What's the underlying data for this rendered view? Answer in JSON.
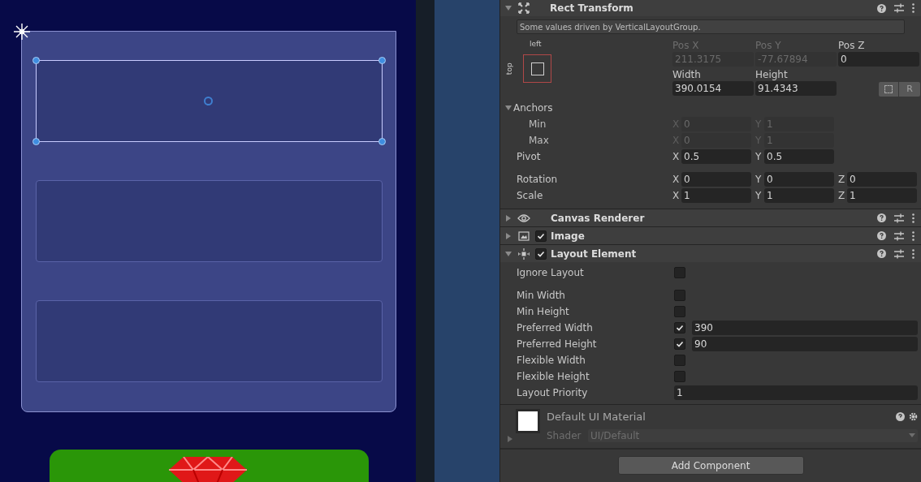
{
  "scene": {
    "slots": [
      {
        "selected": true
      },
      {
        "selected": false
      },
      {
        "selected": false
      }
    ]
  },
  "rect_transform": {
    "title": "Rect Transform",
    "expanded": true,
    "notice": "Some values driven by VerticalLayoutGroup.",
    "anchor_h": "left",
    "anchor_v": "top",
    "pos_fields": [
      {
        "label": "Pos X",
        "value": "211.3175",
        "disabled": true
      },
      {
        "label": "Pos Y",
        "value": "-77.67894",
        "disabled": true
      },
      {
        "label": "Pos Z",
        "value": "0",
        "disabled": false
      }
    ],
    "size_fields": [
      {
        "label": "Width",
        "value": "390.0154",
        "disabled": false
      },
      {
        "label": "Height",
        "value": "91.4343",
        "disabled": false
      }
    ],
    "reset_button": "R",
    "anchors": {
      "label": "Anchors",
      "expanded": true,
      "rows": [
        {
          "label": "Min",
          "disabled": true,
          "fields": [
            {
              "axis": "X",
              "value": "0"
            },
            {
              "axis": "Y",
              "value": "1"
            }
          ]
        },
        {
          "label": "Max",
          "disabled": true,
          "fields": [
            {
              "axis": "X",
              "value": "0"
            },
            {
              "axis": "Y",
              "value": "1"
            }
          ]
        }
      ]
    },
    "pivot": {
      "label": "Pivot",
      "fields": [
        {
          "axis": "X",
          "value": "0.5"
        },
        {
          "axis": "Y",
          "value": "0.5"
        }
      ]
    },
    "vectors": [
      {
        "label": "Rotation",
        "fields": [
          {
            "axis": "X",
            "value": "0"
          },
          {
            "axis": "Y",
            "value": "0"
          },
          {
            "axis": "Z",
            "value": "0"
          }
        ]
      },
      {
        "label": "Scale",
        "fields": [
          {
            "axis": "X",
            "value": "1"
          },
          {
            "axis": "Y",
            "value": "1"
          },
          {
            "axis": "Z",
            "value": "1"
          }
        ]
      }
    ]
  },
  "components": [
    {
      "title": "Canvas Renderer",
      "kind": "eye",
      "expanded": false,
      "has_toggle": false,
      "enabled": true
    },
    {
      "title": "Image",
      "kind": "image",
      "expanded": false,
      "has_toggle": true,
      "enabled": true
    },
    {
      "title": "Layout Element",
      "kind": "layout",
      "expanded": true,
      "has_toggle": true,
      "enabled": true
    }
  ],
  "layout_properties": [
    {
      "label": "Ignore Layout",
      "kind": "checkbox",
      "checked": false
    },
    {
      "label": "Min Width",
      "kind": "checkbox",
      "checked": false
    },
    {
      "label": "Min Height",
      "kind": "checkbox",
      "checked": false
    },
    {
      "label": "Preferred Width",
      "kind": "checkbox",
      "checked": true,
      "value": "390"
    },
    {
      "label": "Preferred Height",
      "kind": "checkbox",
      "checked": true,
      "value": "90"
    },
    {
      "label": "Flexible Width",
      "kind": "checkbox",
      "checked": false
    },
    {
      "label": "Flexible Height",
      "kind": "checkbox",
      "checked": false
    },
    {
      "label": "Layout Priority",
      "kind": "field",
      "value": "1"
    }
  ],
  "material": {
    "name": "Default UI Material",
    "shader_label": "Shader",
    "shader": "UI/Default"
  },
  "add_component": "Add Component"
}
